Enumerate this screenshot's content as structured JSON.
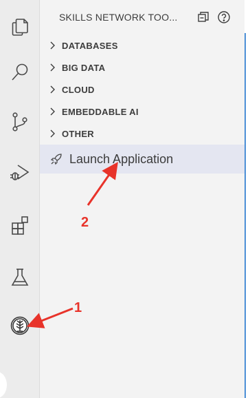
{
  "activity_bar": {
    "icons": [
      "explorer-icon",
      "search-icon",
      "source-control-icon",
      "run-debug-icon",
      "extensions-icon",
      "testing-icon",
      "skills-network-icon"
    ]
  },
  "sidebar": {
    "title": "SKILLS NETWORK TOO...",
    "sections": [
      {
        "label": "DATABASES"
      },
      {
        "label": "BIG DATA"
      },
      {
        "label": "CLOUD"
      },
      {
        "label": "EMBEDDABLE AI"
      },
      {
        "label": "OTHER"
      }
    ],
    "launch_item": {
      "label": "Launch Application"
    }
  },
  "annotations": {
    "label_1": "1",
    "label_2": "2",
    "color": "#e8332a"
  },
  "colors": {
    "activity_bar_bg": "#ececec",
    "sidebar_bg": "#f3f3f3",
    "selected_row_bg": "#e4e6f1",
    "editor_border": "#4b8fd6"
  }
}
